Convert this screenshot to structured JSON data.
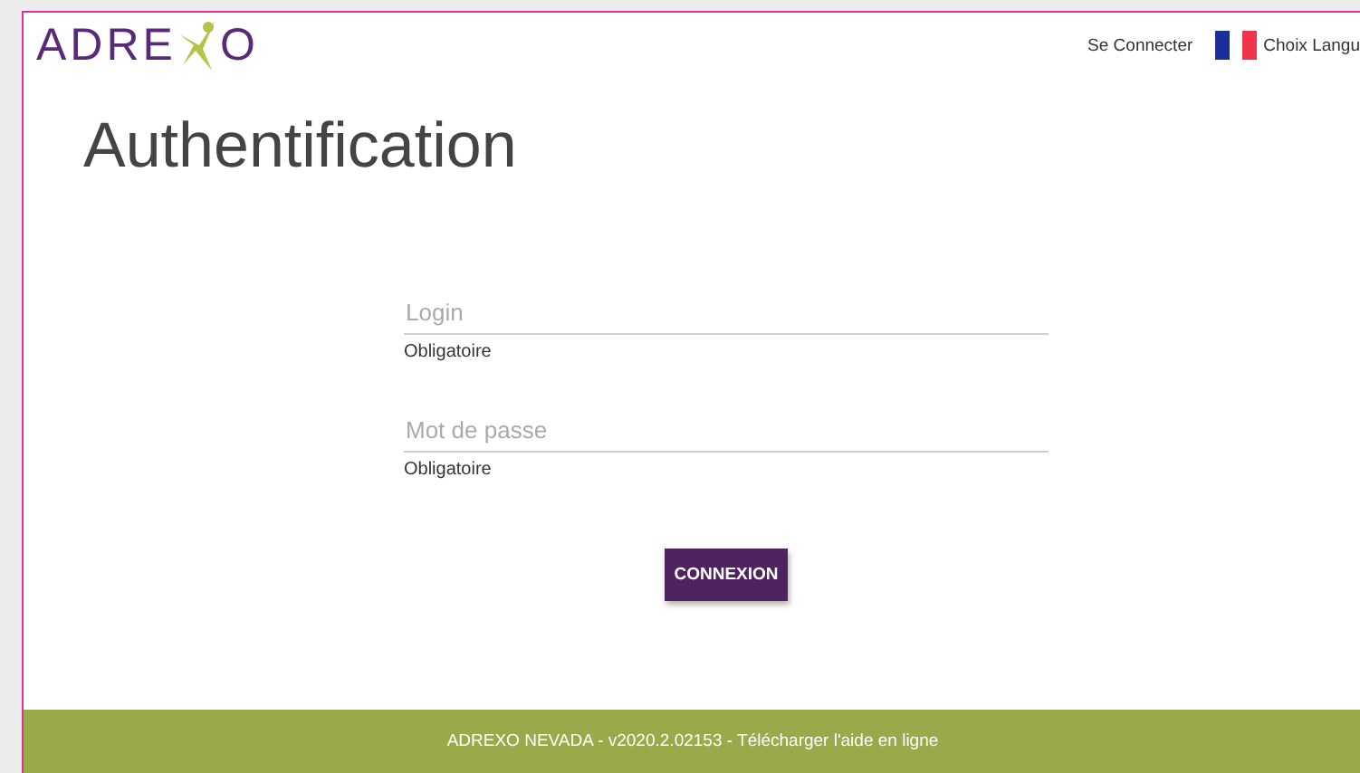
{
  "logo": {
    "left": "ADRE",
    "right": "O"
  },
  "header_links": [
    {
      "label": "Se Connecter",
      "kind": "link"
    },
    {
      "label": "Choix Langu",
      "kind": "language"
    }
  ],
  "title": "Authentification",
  "fields": [
    {
      "placeholder": "Login",
      "hint": "Obligatoire"
    },
    {
      "placeholder": "Mot de passe",
      "hint": "Obligatoire"
    }
  ],
  "button": "CONNEXION",
  "footer": {
    "text": "ADREXO NEVADA - v2020.2.02153 - ",
    "link": "Télécharger l'aide en ligne"
  }
}
